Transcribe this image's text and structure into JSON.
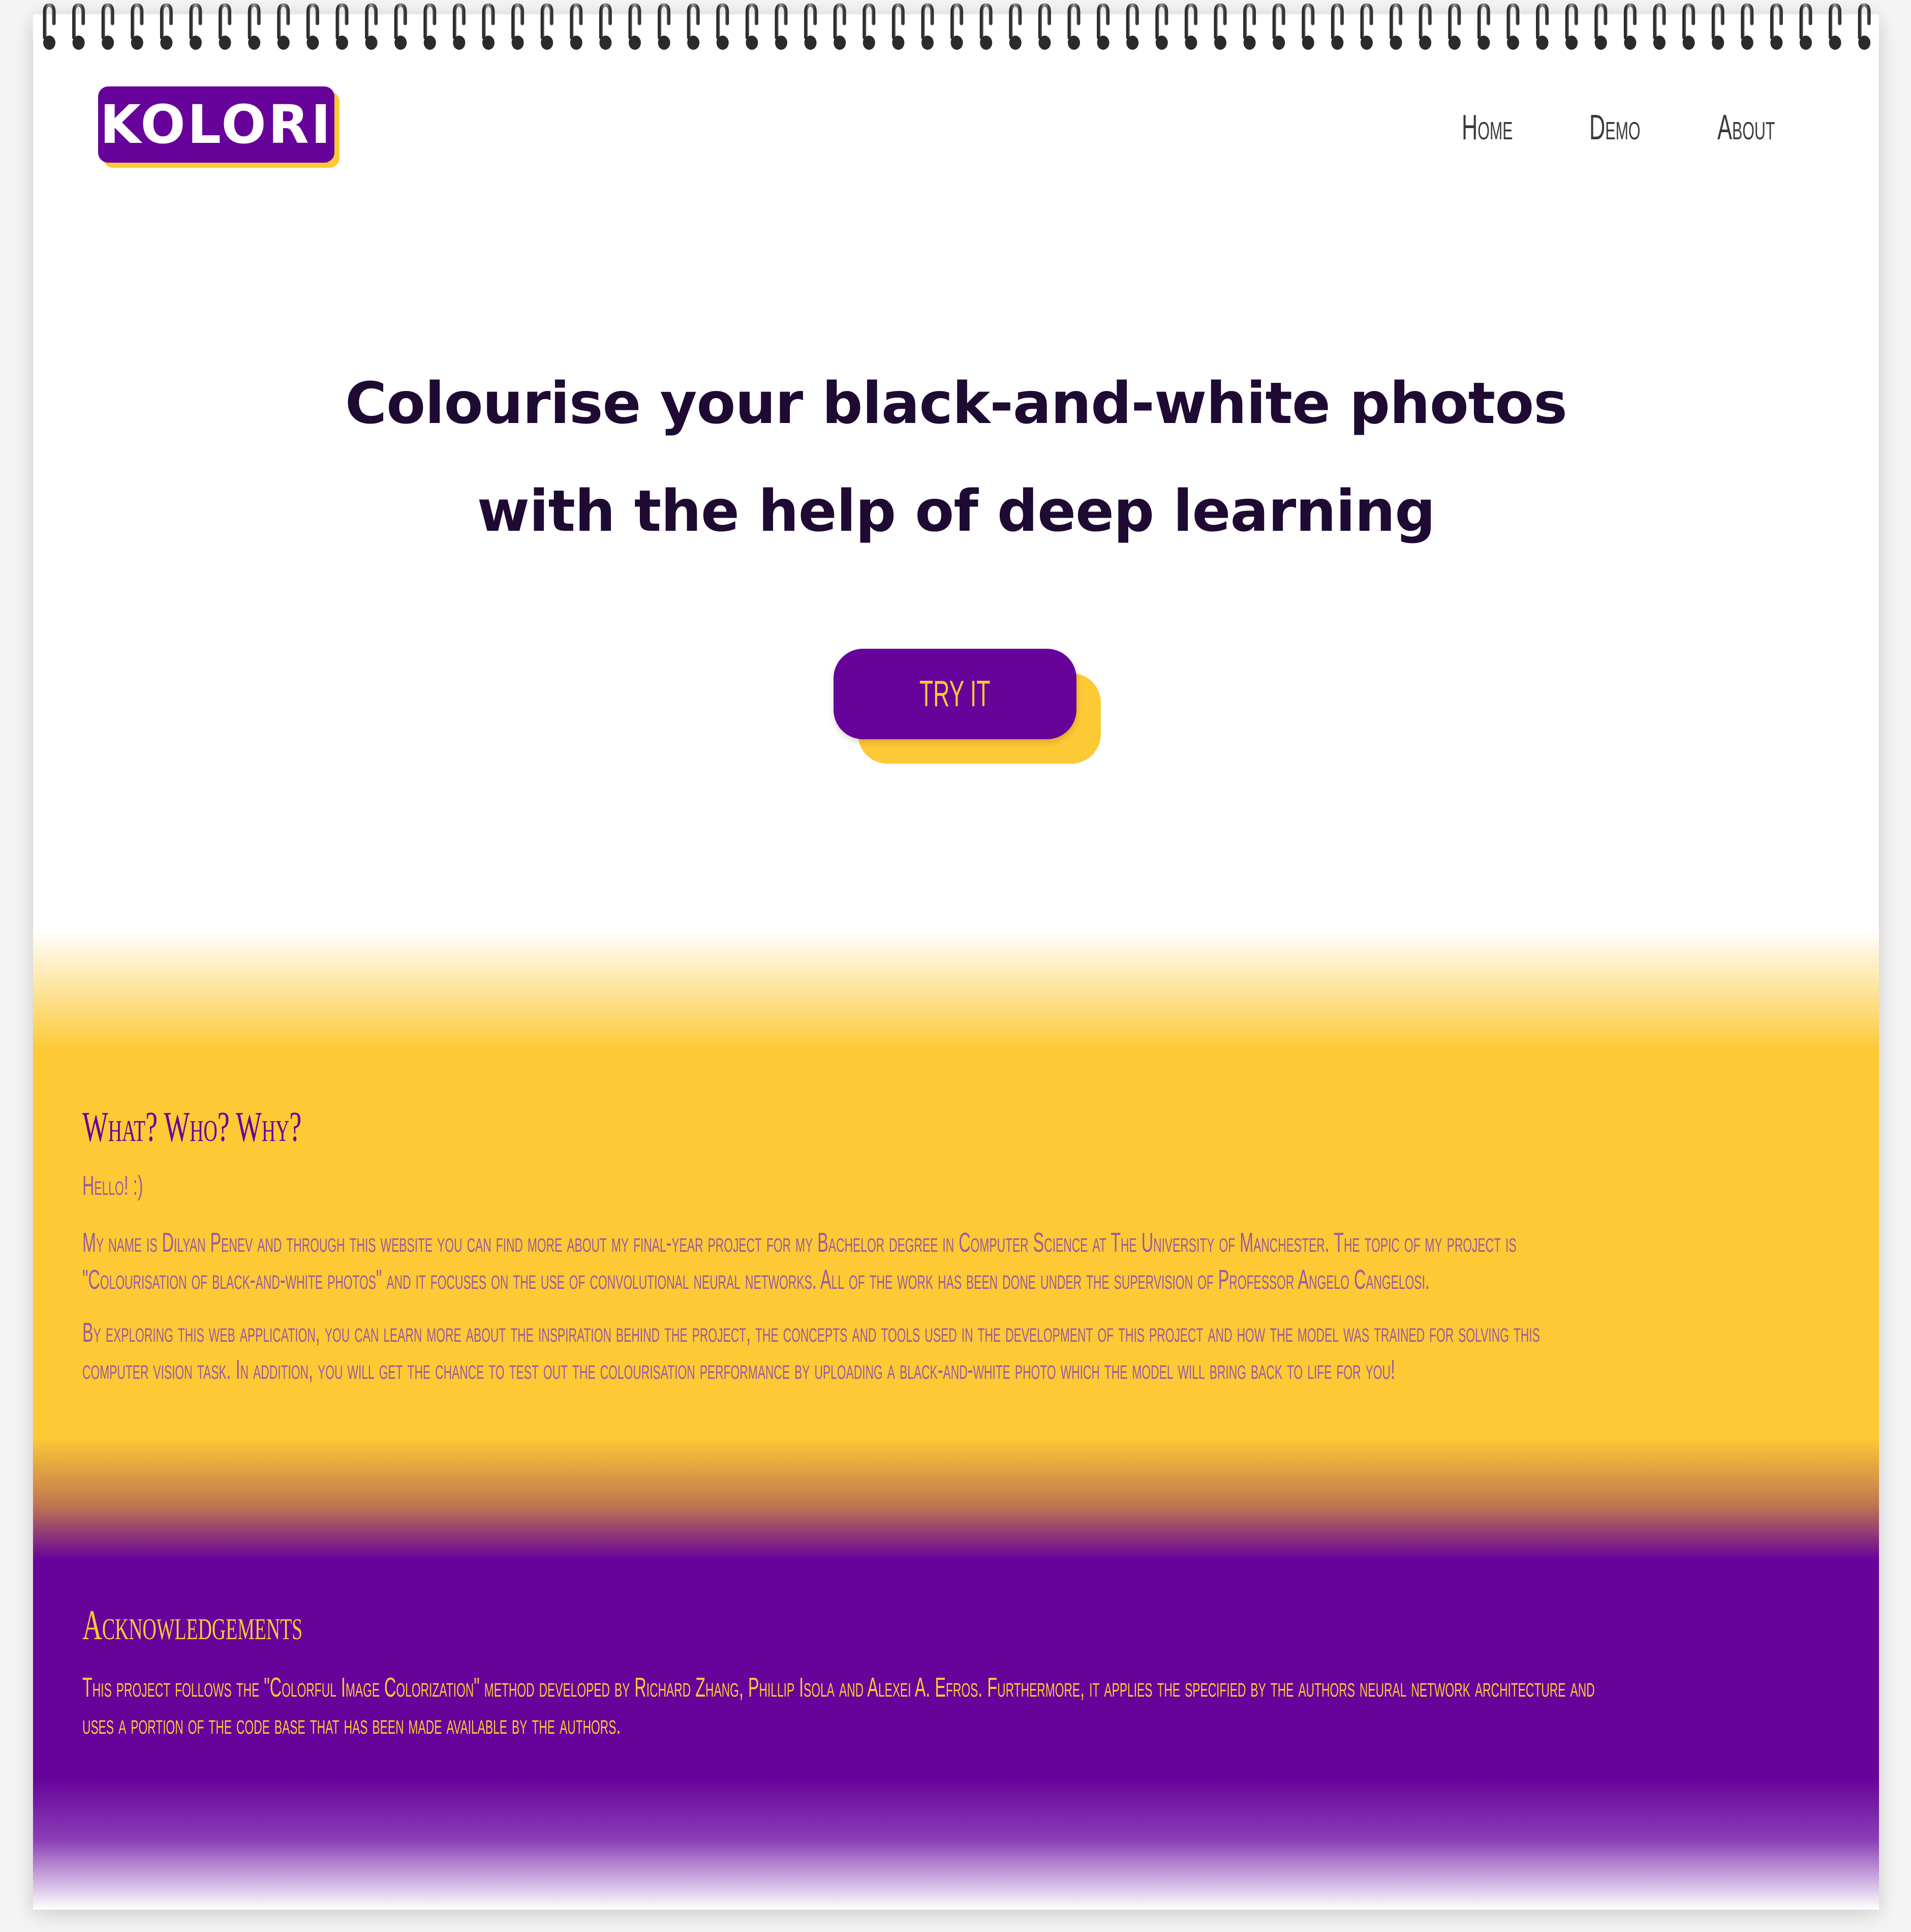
{
  "header": {
    "logo_text": "KOLORI",
    "nav": [
      "Home",
      "Demo",
      "About"
    ]
  },
  "hero": {
    "title_line1": "Colourise your black-and-white photos",
    "title_line2": "with the help of deep learning",
    "cta_label": "TRY IT"
  },
  "about": {
    "title": "What? Who? Why?",
    "greeting": "Hello! :)",
    "paragraph1_line1": "My name is Dilyan Penev and through this website you can find more about my final-year project for my Bachelor degree in Computer Science at The University of Manchester. The topic of my project is",
    "paragraph1_line2": "\"Colourisation of black-and-white photos\" and it focuses on the use of convolutional neural networks. All of the work has been done under the supervision of Professor Angelo Cangelosi.",
    "paragraph2_line1": "By exploring this web application, you can learn more about the inspiration behind the project, the concepts and tools used in the development of this project and how the model was trained for solving this",
    "paragraph2_line2": "computer vision task. In addition, you will get the chance to test out the colourisation performance by uploading a black-and-white photo which the model will bring back to life for you!"
  },
  "acknowledgements": {
    "title": "Acknowledgements",
    "text_line1": "This project follows the \"Colorful Image Colorization\" method developed by Richard Zhang, Phillip Isola and Alexei A. Efros. Furthermore, it applies the specified by the authors neural network architecture and",
    "text_line2": "uses a portion of the code base that has been made available by the authors."
  },
  "colors": {
    "purple": "#67039b",
    "yellow": "#fdc935",
    "ink": "#1e0a32",
    "muted_text": "#9a5aa0"
  },
  "icons": {
    "binding": "spiral-binding"
  }
}
